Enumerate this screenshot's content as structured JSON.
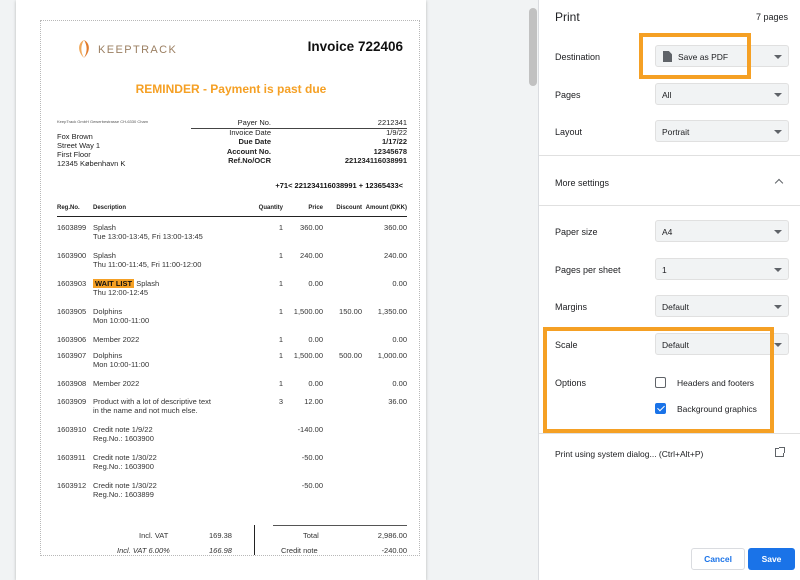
{
  "preview": {
    "logo_text": "KEEPTRACK",
    "invoice_title": "Invoice 722406",
    "reminder": "REMINDER - Payment is past due",
    "company_line": "KeepTrack GmbH Gewerbestrasse CH-6330 Cham",
    "address": [
      "Fox Brown",
      "Street Way 1",
      "First Floor",
      "12345 København K"
    ],
    "meta": [
      {
        "label": "Payer No.",
        "value": "2212341",
        "bold": false
      },
      {
        "label": "Invoice Date",
        "value": "1/9/22",
        "bold": false
      },
      {
        "label": "Due Date",
        "value": "1/17/22",
        "bold": true
      },
      {
        "label": "Account No.",
        "value": "12345678",
        "bold": true
      },
      {
        "label": "Ref.No/OCR",
        "value": "221234116038991",
        "bold": true
      }
    ],
    "ocr_line": "+71< 221234116038991 + 12365433<",
    "columns": {
      "reg": "Reg.No.",
      "desc": "Description",
      "qty": "Quantity",
      "price": "Price",
      "disc": "Discount",
      "amount": "Amount (DKK)"
    },
    "items": [
      {
        "reg": "1603899",
        "desc": "Splash",
        "sub": "Tue 13:00-13:45, Fri 13:00-13:45",
        "badge": "",
        "qty": "1",
        "price": "360.00",
        "disc": "",
        "amount": "360.00"
      },
      {
        "reg": "1603900",
        "desc": "Splash",
        "sub": "Thu 11:00-11:45, Fri 11:00-12:00",
        "badge": "",
        "qty": "1",
        "price": "240.00",
        "disc": "",
        "amount": "240.00"
      },
      {
        "reg": "1603903",
        "desc": "Splash",
        "sub": "Thu 12:00-12:45",
        "badge": "WAIT LIST",
        "qty": "1",
        "price": "0.00",
        "disc": "",
        "amount": "0.00"
      },
      {
        "reg": "1603905",
        "desc": "Dolphins",
        "sub": "Mon 10:00-11:00",
        "badge": "",
        "qty": "1",
        "price": "1,500.00",
        "disc": "150.00",
        "amount": "1,350.00"
      },
      {
        "reg": "1603906",
        "desc": "Member 2022",
        "sub": "",
        "badge": "",
        "qty": "1",
        "price": "0.00",
        "disc": "",
        "amount": "0.00"
      },
      {
        "reg": "1603907",
        "desc": "Dolphins",
        "sub": "Mon 10:00-11:00",
        "badge": "",
        "qty": "1",
        "price": "1,500.00",
        "disc": "500.00",
        "amount": "1,000.00"
      },
      {
        "reg": "1603908",
        "desc": "Member 2022",
        "sub": "",
        "badge": "",
        "qty": "1",
        "price": "0.00",
        "disc": "",
        "amount": "0.00"
      },
      {
        "reg": "1603909",
        "desc": "Product with a lot of descriptive text",
        "sub": "in the name and not much else.",
        "badge": "",
        "qty": "3",
        "price": "12.00",
        "disc": "",
        "amount": "36.00"
      },
      {
        "reg": "1603910",
        "desc": "Credit note  1/9/22",
        "sub": "Reg.No.: 1603900",
        "badge": "",
        "qty": "",
        "price": "-140.00",
        "disc": "",
        "amount": ""
      },
      {
        "reg": "1603911",
        "desc": "Credit note  1/30/22",
        "sub": "Reg.No.: 1603900",
        "badge": "",
        "qty": "",
        "price": "-50.00",
        "disc": "",
        "amount": ""
      },
      {
        "reg": "1603912",
        "desc": "Credit note  1/30/22",
        "sub": "Reg.No.: 1603899",
        "badge": "",
        "qty": "",
        "price": "-50.00",
        "disc": "",
        "amount": ""
      }
    ],
    "totals": {
      "incl_vat_label": "Incl. VAT",
      "incl_vat_value": "169.38",
      "incl_vat_pct_label": "Incl. VAT 6.00%",
      "incl_vat_pct_value": "166.98",
      "total_label": "Total",
      "total_value": "2,986.00",
      "credit_label": "Credit note",
      "credit_value": "-240.00"
    }
  },
  "settings": {
    "title": "Print",
    "pages_count": "7 pages",
    "destination_label": "Destination",
    "destination_value": "Save as PDF",
    "pages_label": "Pages",
    "pages_value": "All",
    "layout_label": "Layout",
    "layout_value": "Portrait",
    "more_settings": "More settings",
    "paper_size_label": "Paper size",
    "paper_size_value": "A4",
    "pages_per_sheet_label": "Pages per sheet",
    "pages_per_sheet_value": "1",
    "margins_label": "Margins",
    "margins_value": "Default",
    "scale_label": "Scale",
    "scale_value": "Default",
    "options_label": "Options",
    "headers_footers": "Headers and footers",
    "headers_footers_checked": false,
    "background_graphics": "Background graphics",
    "background_graphics_checked": true,
    "system_dialog": "Print using system dialog... (Ctrl+Alt+P)",
    "cancel": "Cancel",
    "save": "Save"
  },
  "colors": {
    "highlight": "#f5a024",
    "primary_blue": "#1a73e8"
  }
}
